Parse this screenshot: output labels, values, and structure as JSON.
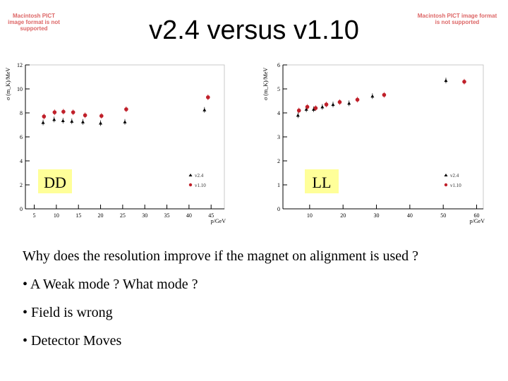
{
  "slide": {
    "title": "v2.4 versus v1.10",
    "pict_placeholder": "Macintosh PICT image format is not supported",
    "question": "Why does the resolution improve if the magnet on alignment is used ?",
    "bullets": [
      "A Weak mode ? What mode ?",
      "Field is wrong",
      "Detector Moves"
    ]
  },
  "colors": {
    "v2.4": "#000000",
    "v1.10": "#c0202a",
    "label_bg": "#ffff99"
  },
  "chart_data": [
    {
      "type": "scatter",
      "label": "DD",
      "xlabel": "p/GeV",
      "ylabel": "σ (m_K)/MeV",
      "xlim": [
        3,
        48
      ],
      "ylim": [
        0,
        12
      ],
      "xticks": [
        5,
        10,
        15,
        20,
        25,
        30,
        35,
        40,
        45
      ],
      "yticks": [
        0,
        2,
        4,
        6,
        8,
        10,
        12
      ],
      "legend": "bottom-right",
      "series": [
        {
          "name": "v2.4",
          "marker": "triangle",
          "x": [
            7,
            9.5,
            11.5,
            13.5,
            16,
            20,
            25.5,
            43.5
          ],
          "y": [
            7.2,
            7.45,
            7.35,
            7.3,
            7.25,
            7.15,
            7.25,
            8.25
          ]
        },
        {
          "name": "v1.10",
          "marker": "circle",
          "x": [
            7.2,
            9.6,
            11.6,
            13.8,
            16.5,
            20.2,
            25.8,
            44.3
          ],
          "y": [
            7.7,
            8.05,
            8.1,
            8.05,
            7.8,
            7.75,
            8.3,
            9.3
          ]
        }
      ]
    },
    {
      "type": "scatter",
      "label": "LL",
      "xlabel": "p/GeV",
      "ylabel": "σ (m_K)/MeV",
      "xlim": [
        2,
        62
      ],
      "ylim": [
        0,
        6
      ],
      "xticks": [
        10,
        20,
        30,
        40,
        50,
        60
      ],
      "yticks": [
        0,
        1,
        2,
        3,
        4,
        5,
        6
      ],
      "legend": "bottom-right",
      "series": [
        {
          "name": "v2.4",
          "marker": "triangle",
          "x": [
            6.5,
            9,
            11.2,
            13.8,
            17,
            21.8,
            28.8,
            50.8
          ],
          "y": [
            3.9,
            4.15,
            4.15,
            4.25,
            4.35,
            4.4,
            4.7,
            5.35
          ]
        },
        {
          "name": "v1.10",
          "marker": "circle",
          "x": [
            6.8,
            9.3,
            11.8,
            15,
            19,
            24.3,
            32.3,
            56.3
          ],
          "y": [
            4.1,
            4.25,
            4.2,
            4.35,
            4.45,
            4.55,
            4.75,
            5.3
          ]
        }
      ]
    }
  ]
}
